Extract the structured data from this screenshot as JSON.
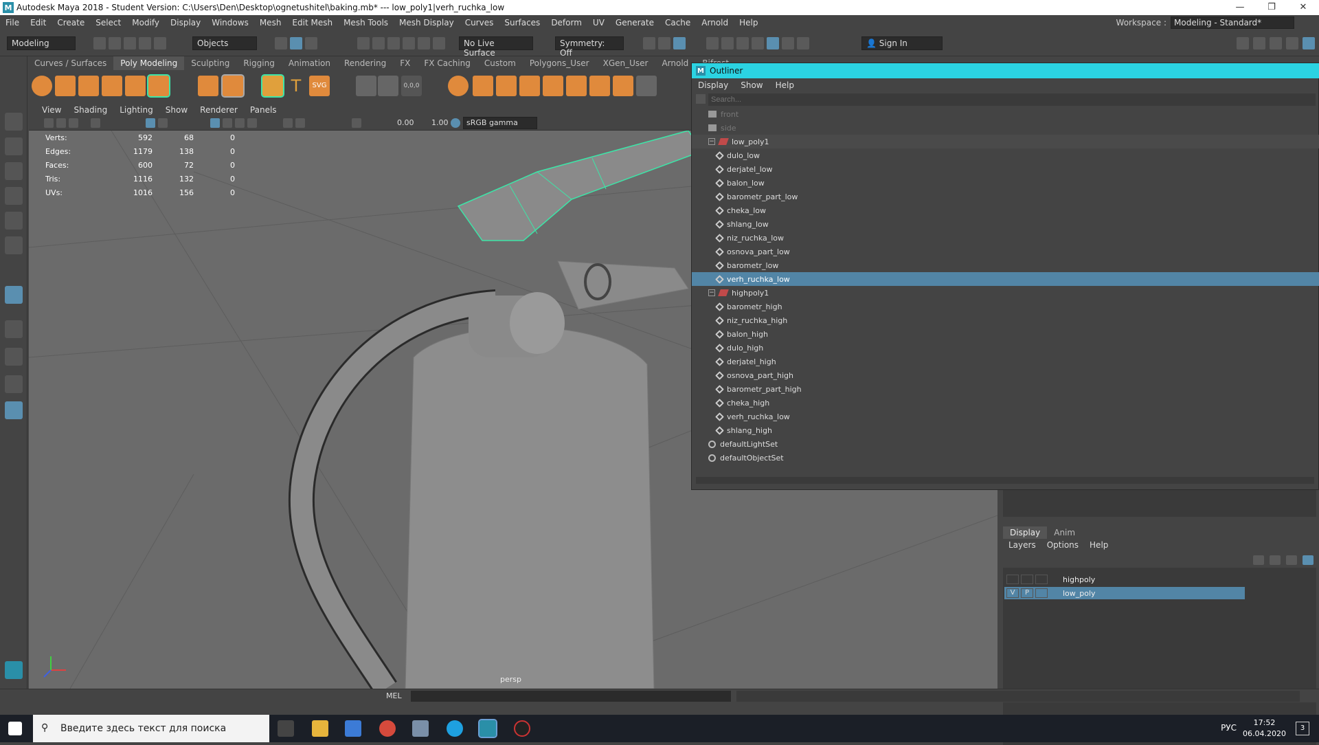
{
  "titlebar": {
    "logo": "M",
    "title": "Autodesk Maya 2018 - Student Version: C:\\Users\\Den\\Desktop\\ognetushitel\\baking.mb*  ---  low_poly1|verh_ruchka_low",
    "min": "—",
    "restore": "❐",
    "close": "✕"
  },
  "menubar": {
    "items": [
      "File",
      "Edit",
      "Create",
      "Select",
      "Modify",
      "Display",
      "Windows",
      "Mesh",
      "Edit Mesh",
      "Mesh Tools",
      "Mesh Display",
      "Curves",
      "Surfaces",
      "Deform",
      "UV",
      "Generate",
      "Cache",
      "Arnold",
      "Help"
    ],
    "workspace_label": "Workspace :",
    "workspace_value": "Modeling - Standard*"
  },
  "toolbar": {
    "mode": "Modeling",
    "objects": "Objects",
    "live_surface": "No Live Surface",
    "symmetry": "Symmetry: Off",
    "sign_in": "Sign In"
  },
  "shelf": {
    "tabs": [
      "Curves / Surfaces",
      "Poly Modeling",
      "Sculpting",
      "Rigging",
      "Animation",
      "Rendering",
      "FX",
      "FX Caching",
      "Custom",
      "Polygons_User",
      "XGen_User",
      "Arnold",
      "Bifrost"
    ],
    "active": "Poly Modeling"
  },
  "viewport": {
    "menu": [
      "View",
      "Shading",
      "Lighting",
      "Show",
      "Renderer",
      "Panels"
    ],
    "gamma_value1": "0.00",
    "gamma_value2": "1.00",
    "colorspace": "sRGB gamma",
    "camera": "persp",
    "hud": [
      {
        "label": "Verts:",
        "a": "592",
        "b": "68",
        "c": "0"
      },
      {
        "label": "Edges:",
        "a": "1179",
        "b": "138",
        "c": "0"
      },
      {
        "label": "Faces:",
        "a": "600",
        "b": "72",
        "c": "0"
      },
      {
        "label": "Tris:",
        "a": "1116",
        "b": "132",
        "c": "0"
      },
      {
        "label": "UVs:",
        "a": "1016",
        "b": "156",
        "c": "0"
      }
    ]
  },
  "outliner": {
    "title": "Outliner",
    "menu": [
      "Display",
      "Show",
      "Help"
    ],
    "search_placeholder": "Search...",
    "rows": [
      {
        "name": "front",
        "type": "camera",
        "indent": 0,
        "dim": true
      },
      {
        "name": "side",
        "type": "camera",
        "indent": 0,
        "dim": true
      },
      {
        "name": "low_poly1",
        "type": "group",
        "indent": 0,
        "expanded": true
      },
      {
        "name": "dulo_low",
        "type": "mesh",
        "indent": 1
      },
      {
        "name": "derjatel_low",
        "type": "mesh",
        "indent": 1
      },
      {
        "name": "balon_low",
        "type": "mesh",
        "indent": 1
      },
      {
        "name": "barometr_part_low",
        "type": "mesh",
        "indent": 1
      },
      {
        "name": "cheka_low",
        "type": "mesh",
        "indent": 1
      },
      {
        "name": "shlang_low",
        "type": "mesh",
        "indent": 1
      },
      {
        "name": "niz_ruchka_low",
        "type": "mesh",
        "indent": 1
      },
      {
        "name": "osnova_part_low",
        "type": "mesh",
        "indent": 1
      },
      {
        "name": "barometr_low",
        "type": "mesh",
        "indent": 1
      },
      {
        "name": "verh_ruchka_low",
        "type": "mesh",
        "indent": 1,
        "selected": true
      },
      {
        "name": "highpoly1",
        "type": "group",
        "indent": 0,
        "expanded": true
      },
      {
        "name": "barometr_high",
        "type": "mesh",
        "indent": 1
      },
      {
        "name": "niz_ruchka_high",
        "type": "mesh",
        "indent": 1
      },
      {
        "name": "balon_high",
        "type": "mesh",
        "indent": 1
      },
      {
        "name": "dulo_high",
        "type": "mesh",
        "indent": 1
      },
      {
        "name": "derjatel_high",
        "type": "mesh",
        "indent": 1
      },
      {
        "name": "osnova_part_high",
        "type": "mesh",
        "indent": 1
      },
      {
        "name": "barometr_part_high",
        "type": "mesh",
        "indent": 1
      },
      {
        "name": "cheka_high",
        "type": "mesh",
        "indent": 1
      },
      {
        "name": "verh_ruchka_low",
        "type": "mesh",
        "indent": 1
      },
      {
        "name": "shlang_high",
        "type": "mesh",
        "indent": 1
      },
      {
        "name": "defaultLightSet",
        "type": "set",
        "indent": 0
      },
      {
        "name": "defaultObjectSet",
        "type": "set",
        "indent": 0
      }
    ]
  },
  "layers": {
    "tabs": [
      "Display",
      "Anim"
    ],
    "menu": [
      "Layers",
      "Options",
      "Help"
    ],
    "items": [
      {
        "v": "",
        "p": "",
        "name": "highpoly",
        "selected": false
      },
      {
        "v": "V",
        "p": "P",
        "name": "low_poly",
        "selected": true
      }
    ]
  },
  "cmdline": {
    "label": "MEL"
  },
  "taskbar": {
    "search_placeholder": "Введите здесь текст для поиска",
    "lang": "РУС",
    "time": "17:52",
    "date": "06.04.2020",
    "notif": "3"
  },
  "colors": {
    "accent": "#5285a6",
    "outliner_title": "#2bd3e2",
    "selection_green": "#3ce6a8"
  }
}
